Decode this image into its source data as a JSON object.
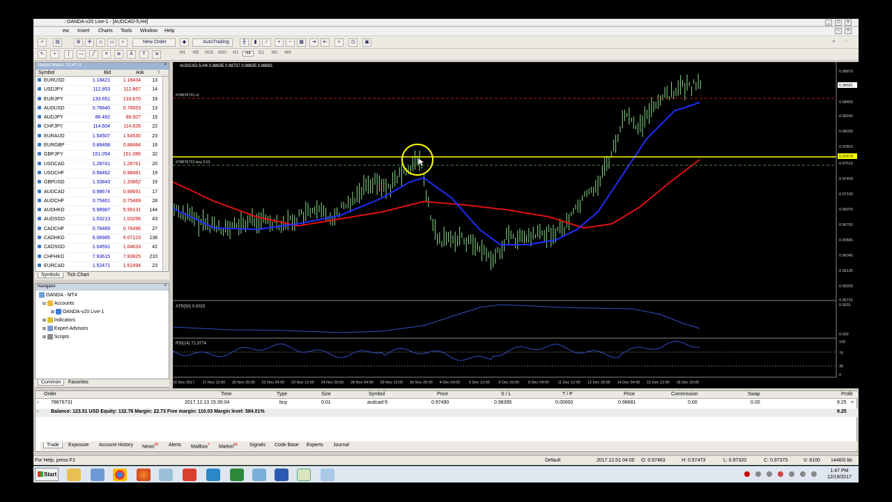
{
  "window": {
    "title": ": OANDA-v20 Live-1 - [AUDCAD-5,H4]"
  },
  "menu": [
    "ew",
    "Insert",
    "Charts",
    "Tools",
    "Window",
    "Help"
  ],
  "toolbar": {
    "new_order": "New Order",
    "autotrading": "AutoTrading",
    "timeframes": [
      "M1",
      "M5",
      "M15",
      "M30",
      "H1",
      "H4",
      "D1",
      "W1",
      "MN"
    ],
    "active_timeframe": "H4"
  },
  "market_watch": {
    "title": "Market Watch: 22:47:11",
    "columns": [
      "Symbol",
      "Bid",
      "Ask",
      "!"
    ],
    "rows": [
      {
        "symbol": "EURUSD",
        "bid": "1.18421",
        "ask": "1.18434",
        "spread": "13"
      },
      {
        "symbol": "USDJPY",
        "bid": "112.853",
        "ask": "112.867",
        "spread": "14"
      },
      {
        "symbol": "EURJPY",
        "bid": "133.651",
        "ask": "133.670",
        "spread": "19"
      },
      {
        "symbol": "AUDUSD",
        "bid": "0.76640",
        "ask": "0.76653",
        "spread": "13"
      },
      {
        "symbol": "AUDJPY",
        "bid": "86.492",
        "ask": "86.507",
        "spread": "15"
      },
      {
        "symbol": "CHFJPY",
        "bid": "114.604",
        "ask": "114.626",
        "spread": "22"
      },
      {
        "symbol": "EURAUD",
        "bid": "1.54507",
        "ask": "1.54530",
        "spread": "23"
      },
      {
        "symbol": "EURGBP",
        "bid": "0.88468",
        "ask": "0.88484",
        "spread": "16"
      },
      {
        "symbol": "GBPJPY",
        "bid": "151.054",
        "ask": "151.086",
        "spread": "32"
      },
      {
        "symbol": "USDCAD",
        "bid": "1.28741",
        "ask": "1.28761",
        "spread": "20"
      },
      {
        "symbol": "USDCHF",
        "bid": "0.98462",
        "ask": "0.98481",
        "spread": "19"
      },
      {
        "symbol": "GBPUSD",
        "bid": "1.33843",
        "ask": "1.33862",
        "spread": "19"
      },
      {
        "symbol": "AUDCAD",
        "bid": "0.98674",
        "ask": "0.98691",
        "spread": "17"
      },
      {
        "symbol": "AUDCHF",
        "bid": "0.75461",
        "ask": "0.75489",
        "spread": "28"
      },
      {
        "symbol": "AUDHKD",
        "bid": "5.98987",
        "ask": "5.99131",
        "spread": "144"
      },
      {
        "symbol": "AUDSGD",
        "bid": "1.03213",
        "ask": "1.03256",
        "spread": "43"
      },
      {
        "symbol": "CADCHF",
        "bid": "0.76469",
        "ask": "0.76496",
        "spread": "27"
      },
      {
        "symbol": "CADHKD",
        "bid": "6.06985",
        "ask": "6.07123",
        "spread": "138"
      },
      {
        "symbol": "CADSGD",
        "bid": "1.04591",
        "ask": "1.04633",
        "spread": "42"
      },
      {
        "symbol": "CHFHKD",
        "bid": "7.93615",
        "ask": "7.93825",
        "spread": "210"
      },
      {
        "symbol": "EURCAD",
        "bid": "1.52471",
        "ask": "1.52494",
        "spread": "23"
      }
    ],
    "tabs": [
      "Symbols",
      "Tick Chart"
    ]
  },
  "navigator": {
    "title": "Navigator",
    "items": [
      "OANDA - MT4",
      "Accounts",
      "OANDA-v20 Live-1",
      "Indicators",
      "Expert Advisors",
      "Scripts"
    ],
    "tabs": [
      "Common",
      "Favorites"
    ]
  },
  "chart": {
    "header": "AUDCAD-5,H4  0.98635 0.98737 0.98635 0.98681",
    "sl_label": "#78876731 sl",
    "buy_label": "#78876731 buy 0.01",
    "atr_label": "ATR(50) 0.0023",
    "rsi_label": "RSI(14) 71.3774",
    "price_labels": [
      "0.98870",
      "0.98681",
      "0.98450",
      "0.98240",
      "0.98030",
      "0.97820",
      "0.97679",
      "0.97610",
      "0.97400",
      "0.97190",
      "0.96975",
      "0.96765",
      "0.96555",
      "0.96345",
      "0.96135",
      "0.95925",
      "0.95715"
    ],
    "atr_scale": [
      "0.0031",
      "0.002"
    ],
    "rsi_scale": [
      "100",
      "70",
      "30",
      "0"
    ],
    "time_labels": [
      "16 Nov 2017",
      "17 Nov 12:00",
      "20 Nov 20:00",
      "22 Nov 04:00",
      "23 Nov 12:00",
      "24 Nov 20:00",
      "28 Nov 04:00",
      "29 Nov 12:00",
      "30 Nov 20:00",
      "4 Dec 04:00",
      "5 Dec 12:00",
      "6 Dec 20:00",
      "8 Dec 04:00",
      "11 Dec 12:00",
      "12 Dec 20:00",
      "14 Dec 04:00",
      "15 Dec 12:00",
      "18 Dec 20:00"
    ],
    "colors": {
      "ma_fast": "#1f2fff",
      "ma_slow": "#e01010",
      "bars": "#8fe08f",
      "hline": "#ffff00"
    }
  },
  "terminal": {
    "columns": [
      "Order",
      "Time",
      "Type",
      "Size",
      "Symbol",
      "Price",
      "S / L",
      "T / P",
      "Price",
      "Commission",
      "Swap",
      "Profit"
    ],
    "order": {
      "order": "78876731",
      "time": "2017.12.13 15:30:04",
      "type": "buy",
      "size": "0.01",
      "symbol": "audcad-5",
      "price": "0.97490",
      "sl": "0.98395",
      "tp": "0.00000",
      "price2": "0.98681",
      "commission": "0.00",
      "swap": "0.00",
      "profit": "9.25"
    },
    "balance_line": "Balance: 123.51 USD  Equity: 132.76  Margin: 22.73  Free margin: 110.03  Margin level: 584.01%",
    "balance_profit": "9.25",
    "tabs": [
      "Trade",
      "Exposure",
      "Account History",
      "News",
      "Alerts",
      "Mailbox",
      "Market",
      "Signals",
      "Code Base",
      "Experts",
      "Journal"
    ],
    "badges": {
      "news": "99",
      "mailbox": "7",
      "market": "66"
    }
  },
  "statusbar": {
    "help": "For Help, press F1",
    "profile": "Default",
    "time": "2017.12.01 04:00",
    "o": "O: 0.97463",
    "h": "H: 0.97473",
    "l": "L: 0.97320",
    "c": "C: 0.97373",
    "v": "V: 8100",
    "traffic": "1446/0 kb"
  },
  "taskbar": {
    "start": "Start",
    "time": "1:47 PM",
    "date": "12/19/2017"
  }
}
